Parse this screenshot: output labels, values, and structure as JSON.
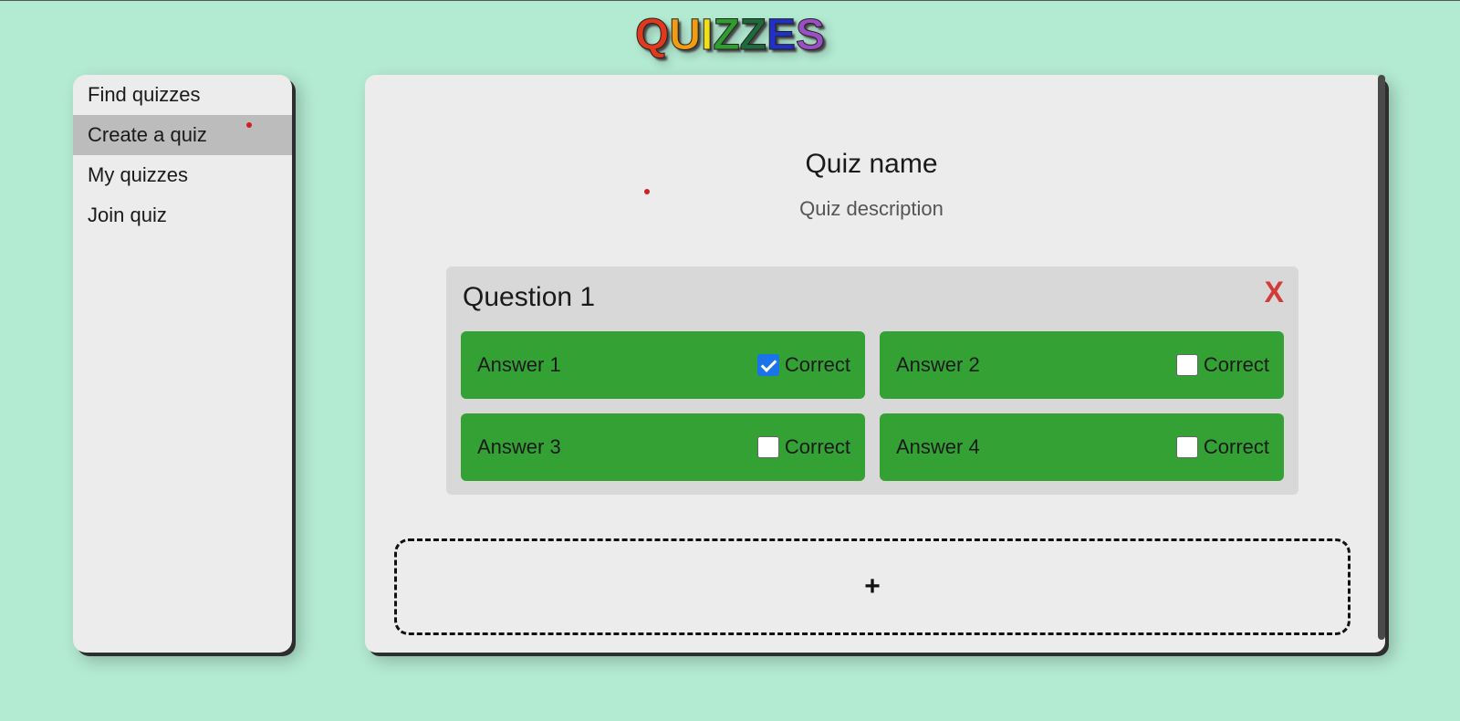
{
  "app": {
    "title_letters": [
      {
        "char": "Q",
        "color": "#e03a1e"
      },
      {
        "char": "U",
        "color": "#f39c12"
      },
      {
        "char": "I",
        "color": "#f1e019"
      },
      {
        "char": "Z",
        "color": "#2e9e2e"
      },
      {
        "char": "Z",
        "color": "#1d6b3a"
      },
      {
        "char": "E",
        "color": "#2030c8"
      },
      {
        "char": "S",
        "color": "#9b4fc4"
      }
    ]
  },
  "sidebar": {
    "items": [
      {
        "label": "Find quizzes",
        "active": false
      },
      {
        "label": "Create a quiz",
        "active": true
      },
      {
        "label": "My quizzes",
        "active": false
      },
      {
        "label": "Join quiz",
        "active": false
      }
    ]
  },
  "quiz": {
    "name_placeholder": "Quiz name",
    "description_placeholder": "Quiz description",
    "questions": [
      {
        "title": "Question 1",
        "delete_label": "X",
        "answers": [
          {
            "label": "Answer 1",
            "correct_label": "Correct",
            "correct": true
          },
          {
            "label": "Answer 2",
            "correct_label": "Correct",
            "correct": false
          },
          {
            "label": "Answer 3",
            "correct_label": "Correct",
            "correct": false
          },
          {
            "label": "Answer 4",
            "correct_label": "Correct",
            "correct": false
          }
        ]
      }
    ],
    "add_question_label": "+"
  },
  "colors": {
    "background": "#b3ead2",
    "panel": "#ececec",
    "question_card": "#d8d8d8",
    "answer": "#33a133",
    "delete": "#d33a3a",
    "active_nav": "#bcbcbc"
  }
}
